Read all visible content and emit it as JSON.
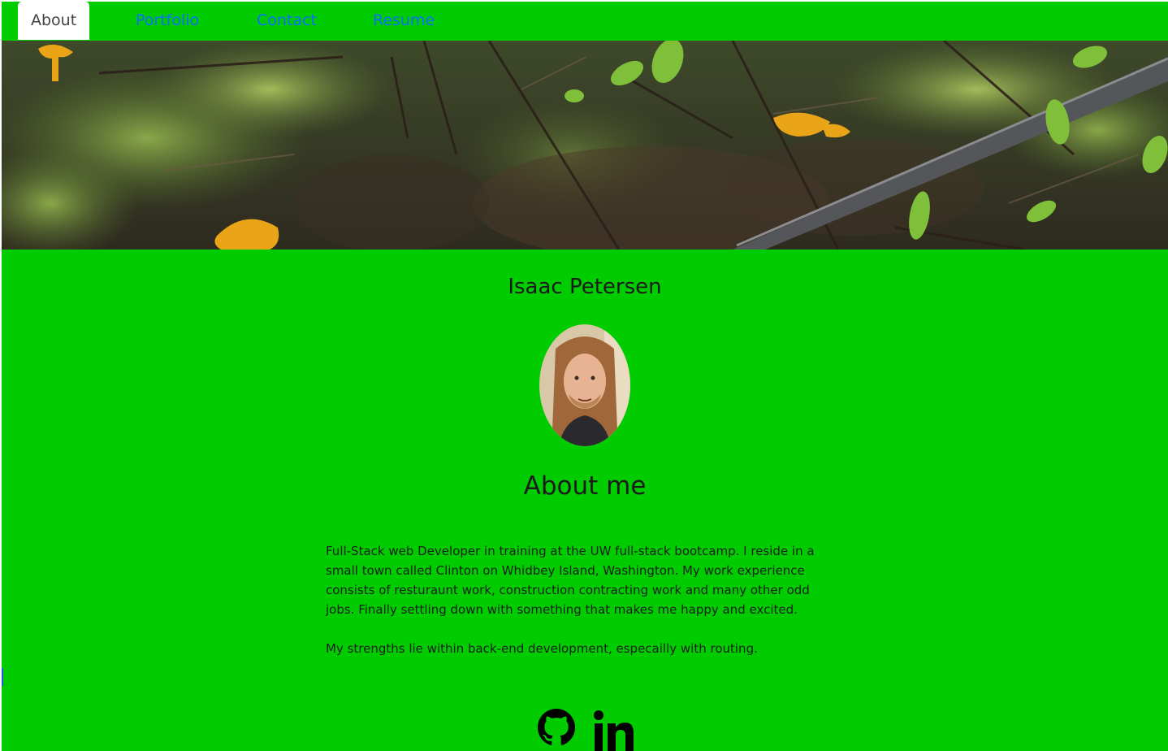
{
  "nav": {
    "tabs": [
      {
        "label": "About",
        "active": true
      },
      {
        "label": "Portfolio",
        "active": false
      },
      {
        "label": "Contact",
        "active": false
      },
      {
        "label": "Resume",
        "active": false
      }
    ]
  },
  "hero": {
    "image": "forest-floor-with-chanterelle-mushrooms"
  },
  "profile": {
    "name": "Isaac Petersen",
    "avatar": "profile-photo"
  },
  "about": {
    "title": "About me",
    "paragraphs": [
      "Full-Stack web Developer in training at the UW full-stack bootcamp. I reside in a small town called Clinton on Whidbey Island, Washington. My work experience consists of resturaunt work, construction contracting work and many other odd jobs. Finally settling down with something that makes me happy and excited.",
      "My strengths lie within back-end development, especailly with routing."
    ]
  },
  "socials": [
    {
      "icon": "github-icon"
    },
    {
      "icon": "linkedin-icon"
    }
  ],
  "colors": {
    "page_background": "#00cc00",
    "nav_link": "#0d6efd",
    "active_tab_bg": "#ffffff",
    "text": "#1b1b1b"
  }
}
